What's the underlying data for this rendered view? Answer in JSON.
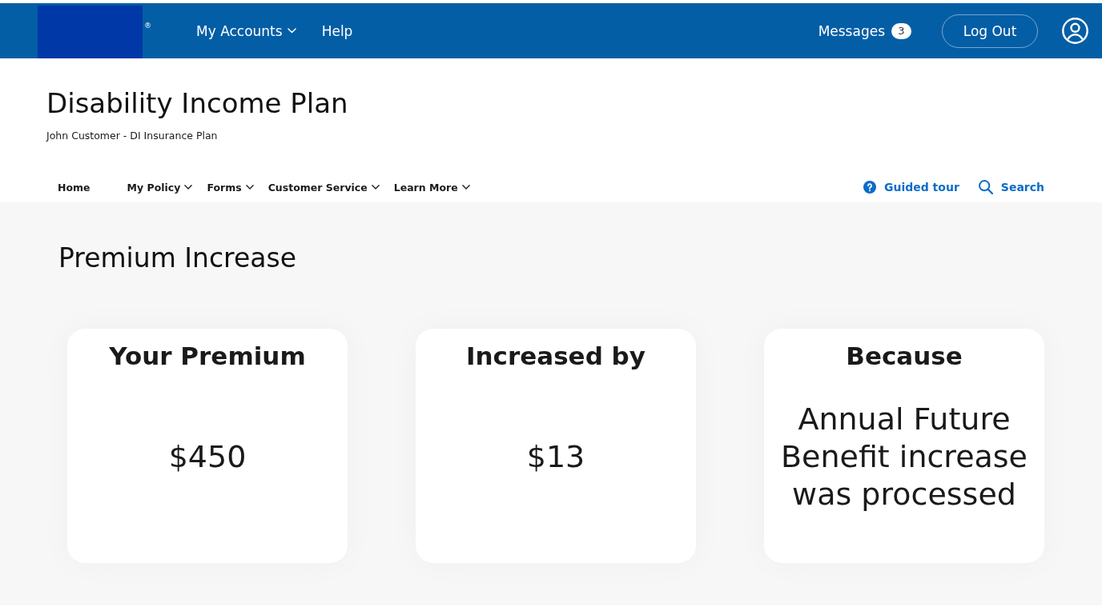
{
  "header": {
    "logo_mark": "®",
    "menu": [
      {
        "label": "My Accounts",
        "has_dropdown": true
      },
      {
        "label": "Help",
        "has_dropdown": false
      }
    ],
    "messages": {
      "label": "Messages",
      "count": "3"
    },
    "logout_button": "Log Out"
  },
  "page": {
    "title": "Disability Income Plan",
    "subtitle": "John Customer - DI Insurance Plan"
  },
  "nav": {
    "items": [
      {
        "label": "Home",
        "has_dropdown": false
      },
      {
        "label": "My Policy",
        "has_dropdown": true
      },
      {
        "label": "Forms",
        "has_dropdown": true
      },
      {
        "label": "Customer Service",
        "has_dropdown": true
      },
      {
        "label": "Learn More",
        "has_dropdown": true
      }
    ],
    "actions": [
      {
        "kind": "help",
        "label": "Guided tour"
      },
      {
        "kind": "search",
        "label": "Search"
      }
    ]
  },
  "section": {
    "title": "Premium Increase",
    "cards": [
      {
        "title": "Your Premium",
        "value": "$450"
      },
      {
        "title": "Increased by",
        "value": "$13"
      },
      {
        "title": "Because",
        "value": "Annual Future Benefit increase was processed"
      }
    ]
  }
}
